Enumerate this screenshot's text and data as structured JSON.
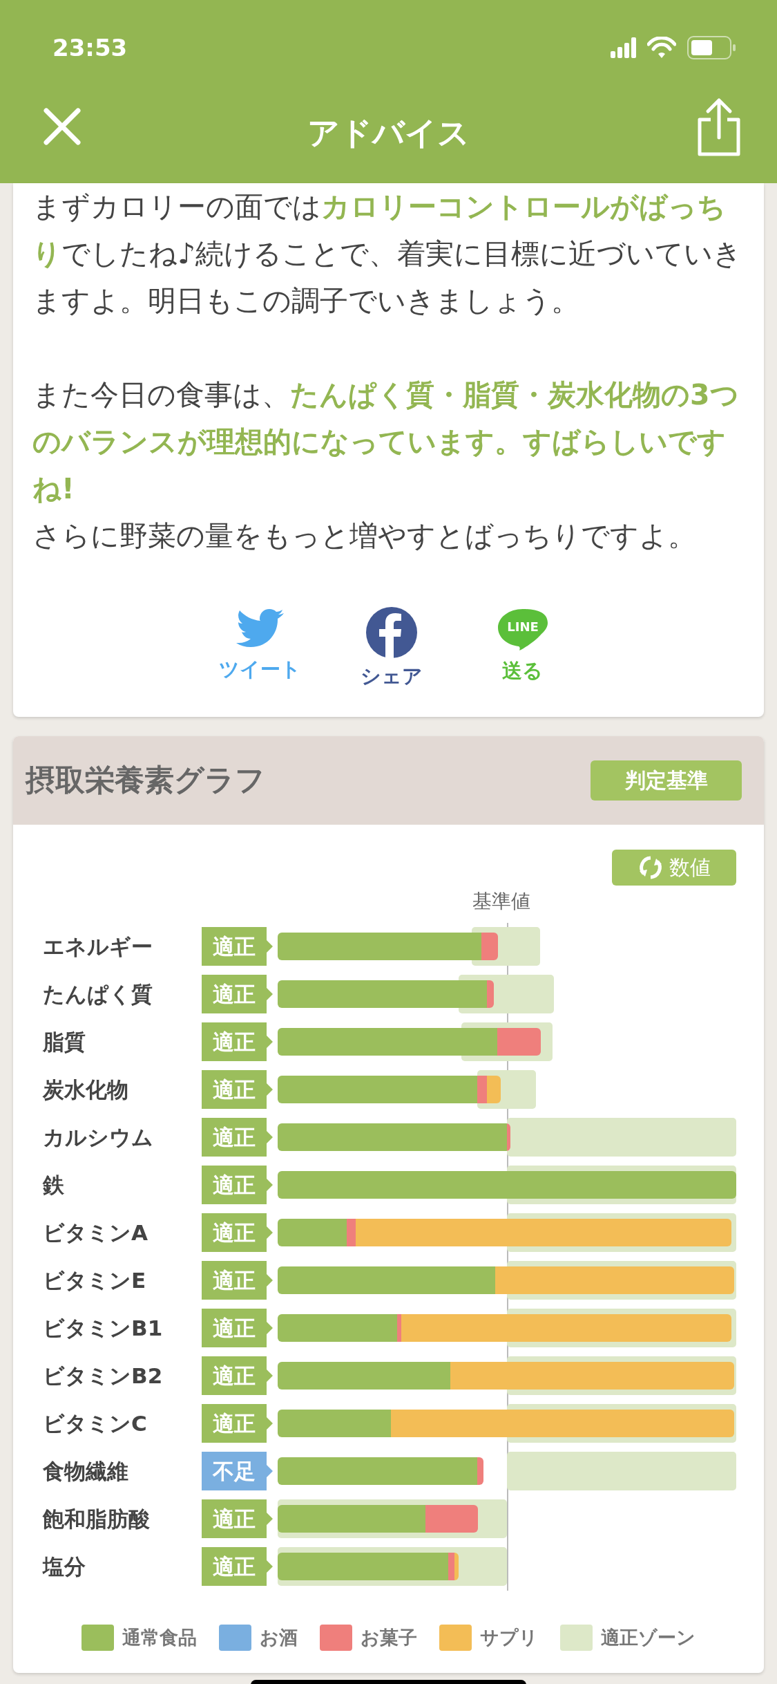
{
  "status_bar": {
    "time": "23:53"
  },
  "header": {
    "title": "アドバイス"
  },
  "advice": {
    "blocks": [
      [
        "まずカロリーの面では**カロリーコントロールがばっちり**でしたね♪続けることで、着実に目標に近づいていきますよ。明日もこの調子でいきましょう。"
      ],
      [
        "また今日の食事は、**たんぱく質・脂質・炭水化物の3つのバランスが理想的になっています。すばらしいですね!**",
        "さらに野菜の量をもっと増やすとばっちりですよ。"
      ]
    ],
    "share": [
      {
        "kind": "twitter",
        "label": "ツイート"
      },
      {
        "kind": "facebook",
        "label": "シェア"
      },
      {
        "kind": "line",
        "label": "送る",
        "icon_text": "LINE"
      }
    ]
  },
  "nutrient_graph": {
    "title": "摂取栄養素グラフ",
    "criteria_button": "判定基準",
    "toggle_button": "数値",
    "reference_label": "基準値",
    "rows": [
      {
        "name": "エネルギー",
        "status": "適正",
        "kind": "ok"
      },
      {
        "name": "たんぱく質",
        "status": "適正",
        "kind": "ok"
      },
      {
        "name": "脂質",
        "status": "適正",
        "kind": "ok"
      },
      {
        "name": "炭水化物",
        "status": "適正",
        "kind": "ok"
      },
      {
        "name": "カルシウム",
        "status": "適正",
        "kind": "ok"
      },
      {
        "name": "鉄",
        "status": "適正",
        "kind": "ok"
      },
      {
        "name": "ビタミンA",
        "status": "適正",
        "kind": "ok"
      },
      {
        "name": "ビタミンE",
        "status": "適正",
        "kind": "ok"
      },
      {
        "name": "ビタミンB1",
        "status": "適正",
        "kind": "ok"
      },
      {
        "name": "ビタミンB2",
        "status": "適正",
        "kind": "ok"
      },
      {
        "name": "ビタミンC",
        "status": "適正",
        "kind": "ok"
      },
      {
        "name": "食物繊維",
        "status": "不足",
        "kind": "short"
      },
      {
        "name": "飽和脂肪酸",
        "status": "適正",
        "kind": "ok"
      },
      {
        "name": "塩分",
        "status": "適正",
        "kind": "ok"
      }
    ],
    "legend": [
      {
        "kind": "normal",
        "label": "通常食品",
        "color": "#9bbe5c"
      },
      {
        "kind": "alcohol",
        "label": "お酒",
        "color": "#7aafe0"
      },
      {
        "kind": "snack",
        "label": "お菓子",
        "color": "#ef7f7c"
      },
      {
        "kind": "supplement",
        "label": "サプリ",
        "color": "#f3bd56"
      },
      {
        "kind": "zone",
        "label": "適正ゾーン",
        "color": "#dde8c8"
      }
    ]
  }
}
